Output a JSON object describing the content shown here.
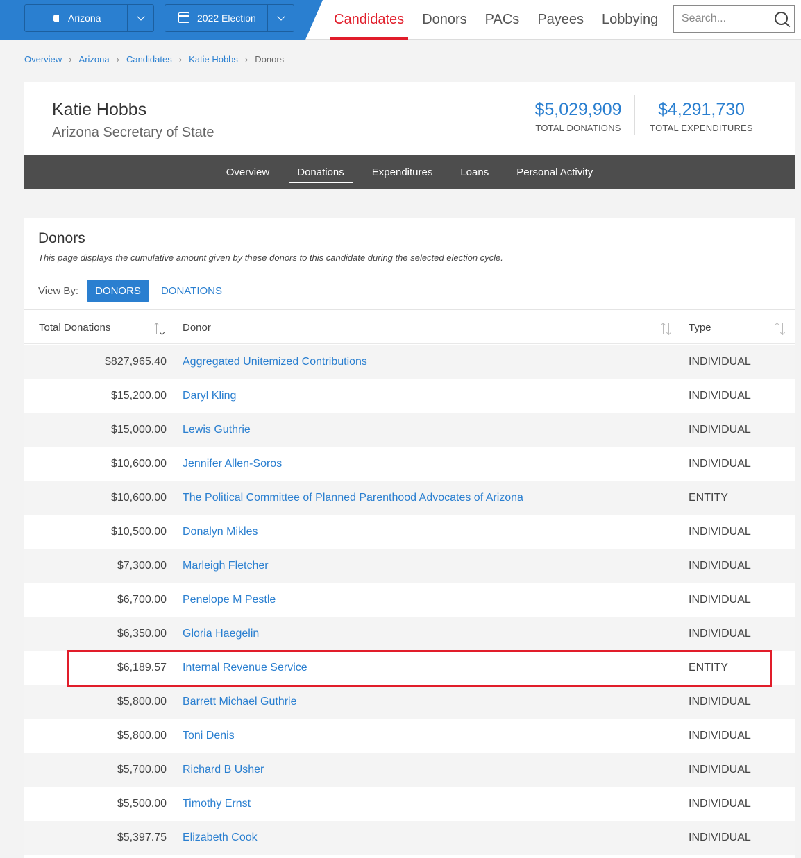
{
  "topbar": {
    "state_selector": {
      "label": "Arizona"
    },
    "cycle_selector": {
      "label": "2022 Election"
    },
    "nav": [
      {
        "label": "Candidates",
        "active": true
      },
      {
        "label": "Donors",
        "active": false
      },
      {
        "label": "PACs",
        "active": false
      },
      {
        "label": "Payees",
        "active": false
      },
      {
        "label": "Lobbying",
        "active": false
      }
    ],
    "search": {
      "placeholder": "Search...",
      "value": ""
    }
  },
  "breadcrumb": [
    "Overview",
    "Arizona",
    "Candidates",
    "Katie Hobbs",
    "Donors"
  ],
  "profile": {
    "name": "Katie Hobbs",
    "office": "Arizona Secretary of State",
    "total_donations": {
      "amount": "$5,029,909",
      "label": "TOTAL DONATIONS"
    },
    "total_expenditures": {
      "amount": "$4,291,730",
      "label": "TOTAL EXPENDITURES"
    }
  },
  "subnav": [
    {
      "label": "Overview",
      "active": false
    },
    {
      "label": "Donations",
      "active": true
    },
    {
      "label": "Expenditures",
      "active": false
    },
    {
      "label": "Loans",
      "active": false
    },
    {
      "label": "Personal Activity",
      "active": false
    }
  ],
  "donors_panel": {
    "title": "Donors",
    "description": "This page displays the cumulative amount given by these donors to this candidate during the selected election cycle.",
    "view_by_label": "View By:",
    "view_by_options": [
      {
        "label": "DONORS",
        "active": true
      },
      {
        "label": "DONATIONS",
        "active": false
      }
    ],
    "columns": [
      "Total Donations",
      "Donor",
      "Type"
    ],
    "rows": [
      {
        "amount": "$827,965.40",
        "donor": "Aggregated Unitemized Contributions",
        "type": "INDIVIDUAL"
      },
      {
        "amount": "$15,200.00",
        "donor": "Daryl Kling",
        "type": "INDIVIDUAL"
      },
      {
        "amount": "$15,000.00",
        "donor": "Lewis Guthrie",
        "type": "INDIVIDUAL"
      },
      {
        "amount": "$10,600.00",
        "donor": "Jennifer Allen-Soros",
        "type": "INDIVIDUAL"
      },
      {
        "amount": "$10,600.00",
        "donor": "The Political Committee of Planned Parenthood Advocates of Arizona",
        "type": "ENTITY"
      },
      {
        "amount": "$10,500.00",
        "donor": "Donalyn Mikles",
        "type": "INDIVIDUAL"
      },
      {
        "amount": "$7,300.00",
        "donor": "Marleigh Fletcher",
        "type": "INDIVIDUAL"
      },
      {
        "amount": "$6,700.00",
        "donor": "Penelope M Pestle",
        "type": "INDIVIDUAL"
      },
      {
        "amount": "$6,350.00",
        "donor": "Gloria Haegelin",
        "type": "INDIVIDUAL"
      },
      {
        "amount": "$6,189.57",
        "donor": "Internal Revenue Service",
        "type": "ENTITY",
        "highlighted": true
      },
      {
        "amount": "$5,800.00",
        "donor": "Barrett Michael Guthrie",
        "type": "INDIVIDUAL"
      },
      {
        "amount": "$5,800.00",
        "donor": "Toni Denis",
        "type": "INDIVIDUAL"
      },
      {
        "amount": "$5,700.00",
        "donor": "Richard B Usher",
        "type": "INDIVIDUAL"
      },
      {
        "amount": "$5,500.00",
        "donor": "Timothy Ernst",
        "type": "INDIVIDUAL"
      },
      {
        "amount": "$5,397.75",
        "donor": "Elizabeth Cook",
        "type": "INDIVIDUAL"
      }
    ]
  },
  "colors": {
    "brand_blue": "#2a7fd0",
    "active_red": "#e11d2a",
    "subnav_bg": "#4d4d4d"
  }
}
